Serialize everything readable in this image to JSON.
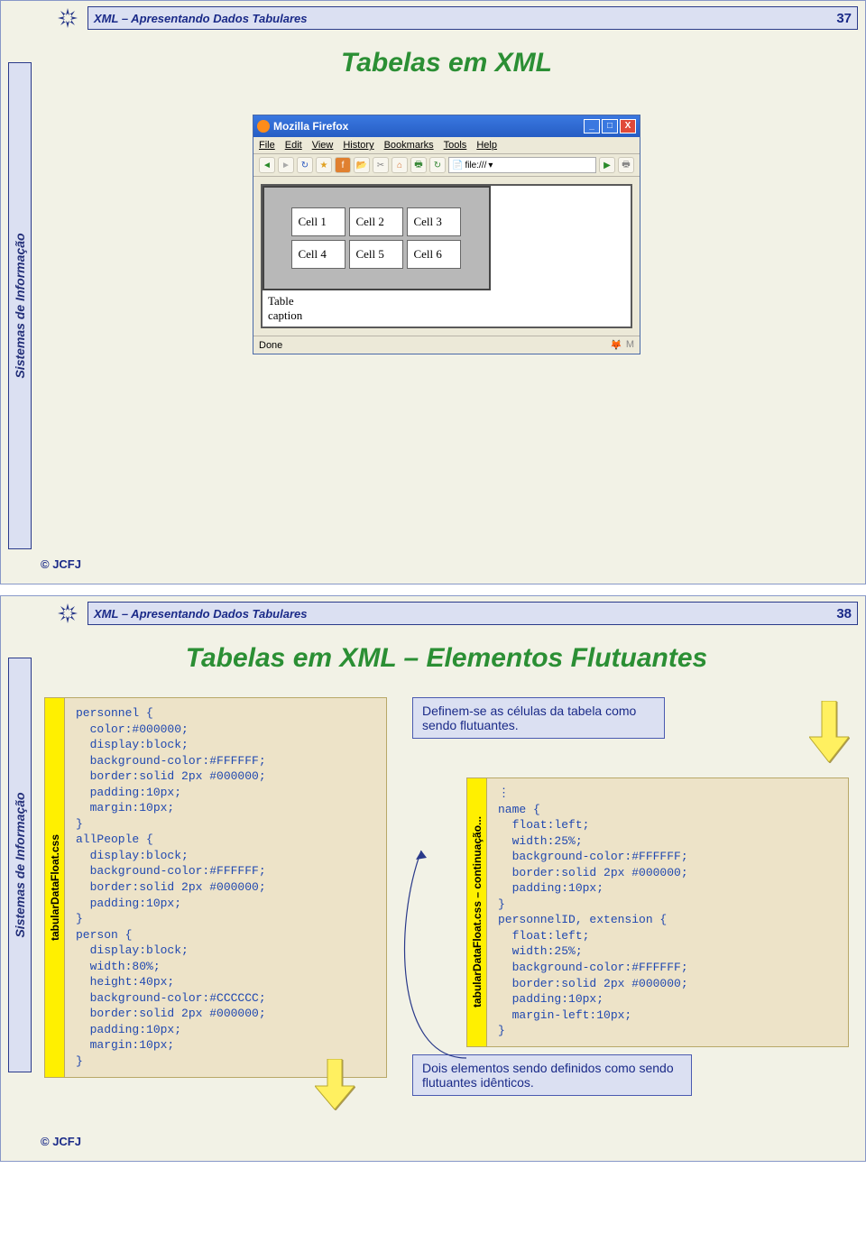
{
  "slides": [
    {
      "breadcrumb": "XML – Apresentando Dados Tabulares",
      "page": "37",
      "sidebar": "Sistemas de Informação",
      "title": "Tabelas em XML",
      "footer": "© JCFJ",
      "browser": {
        "title": "Mozilla Firefox",
        "menu": [
          "File",
          "Edit",
          "View",
          "History",
          "Bookmarks",
          "Tools",
          "Help"
        ],
        "urlPrefix": "file:///",
        "status": "Done",
        "cells": [
          "Cell 1",
          "Cell 2",
          "Cell 3",
          "Cell 4",
          "Cell 5",
          "Cell 6"
        ],
        "caption": "Table\ncaption"
      }
    },
    {
      "breadcrumb": "XML – Apresentando Dados Tabulares",
      "page": "38",
      "sidebar": "Sistemas de Informação",
      "title": "Tabelas em XML – Elementos Flutuantes",
      "footer": "© JCFJ",
      "note1": "Definem-se as células da tabela como sendo flutuantes.",
      "note2": "Dois elementos sendo definidos como sendo flutuantes idênticos.",
      "codeLabel1": "tabularDataFloat.css",
      "codeLabel2": "tabularDataFloat.css – continuação...",
      "code1": "personnel {\n  color:#000000;\n  display:block;\n  background-color:#FFFFFF;\n  border:solid 2px #000000;\n  padding:10px;\n  margin:10px;\n}\nallPeople {\n  display:block;\n  background-color:#FFFFFF;\n  border:solid 2px #000000;\n  padding:10px;\n}\nperson {\n  display:block;\n  width:80%;\n  height:40px;\n  background-color:#CCCCCC;\n  border:solid 2px #000000;\n  padding:10px;\n  margin:10px;\n}",
      "code2": "⋮\nname {\n  float:left;\n  width:25%;\n  background-color:#FFFFFF;\n  border:solid 2px #000000;\n  padding:10px;\n}\npersonnelID, extension {\n  float:left;\n  width:25%;\n  background-color:#FFFFFF;\n  border:solid 2px #000000;\n  padding:10px;\n  margin-left:10px;\n}"
    }
  ]
}
